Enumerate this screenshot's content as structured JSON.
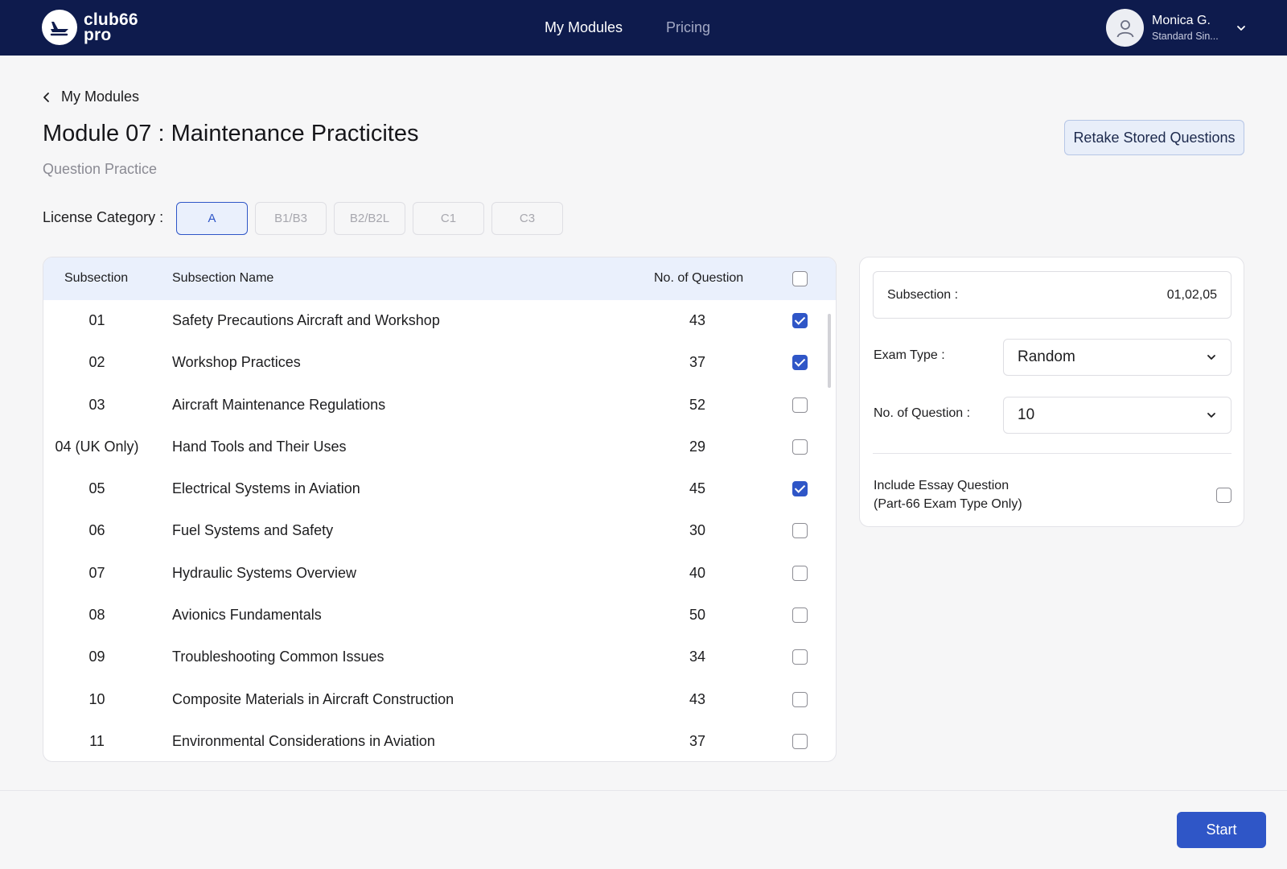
{
  "header": {
    "logo_line1": "club66",
    "logo_line2": "pro",
    "nav": [
      {
        "label": "My Modules"
      },
      {
        "label": "Pricing"
      }
    ],
    "user": {
      "name": "Monica G.",
      "plan": "Standard Sin..."
    }
  },
  "breadcrumb": {
    "back_label": "My Modules"
  },
  "page": {
    "title": "Module 07 : Maintenance Practicites",
    "subtitle": "Question Practice",
    "retake_label": "Retake Stored Questions"
  },
  "license": {
    "label": "License Category :",
    "options": [
      "A",
      "B1/B3",
      "B2/B2L",
      "C1",
      "C3"
    ],
    "selected": "A"
  },
  "table": {
    "headers": {
      "subsection": "Subsection",
      "name": "Subsection Name",
      "count": "No. of Question"
    },
    "rows": [
      {
        "sub": "01",
        "name": "Safety Precautions Aircraft and Workshop",
        "count": "43",
        "checked": true
      },
      {
        "sub": "02",
        "name": "Workshop Practices",
        "count": "37",
        "checked": true
      },
      {
        "sub": "03",
        "name": "Aircraft Maintenance Regulations",
        "count": "52",
        "checked": false
      },
      {
        "sub": "04 (UK Only)",
        "name": "Hand Tools and Their Uses",
        "count": "29",
        "checked": false
      },
      {
        "sub": "05",
        "name": "Electrical Systems in Aviation",
        "count": "45",
        "checked": true
      },
      {
        "sub": "06",
        "name": "Fuel Systems and Safety",
        "count": "30",
        "checked": false
      },
      {
        "sub": "07",
        "name": "Hydraulic Systems Overview",
        "count": "40",
        "checked": false
      },
      {
        "sub": "08",
        "name": "Avionics Fundamentals",
        "count": "50",
        "checked": false
      },
      {
        "sub": "09",
        "name": "Troubleshooting Common Issues",
        "count": "34",
        "checked": false
      },
      {
        "sub": "10",
        "name": "Composite Materials in Aircraft Construction",
        "count": "43",
        "checked": false
      },
      {
        "sub": "11",
        "name": "Environmental Considerations in Aviation",
        "count": "37",
        "checked": false
      }
    ]
  },
  "panel": {
    "subsection_label": "Subsection :",
    "subsection_value": "01,02,05",
    "exam_type_label": "Exam Type :",
    "exam_type_value": "Random",
    "num_questions_label": "No. of Question :",
    "num_questions_value": "10",
    "essay_line1": "Include Essay Question",
    "essay_line2": "(Part-66 Exam Type Only)",
    "essay_checked": false
  },
  "footer": {
    "start_label": "Start"
  },
  "colors": {
    "navbar": "#0e1b4d",
    "accent": "#2f56c7",
    "table_header_bg": "#eaf0fc"
  }
}
